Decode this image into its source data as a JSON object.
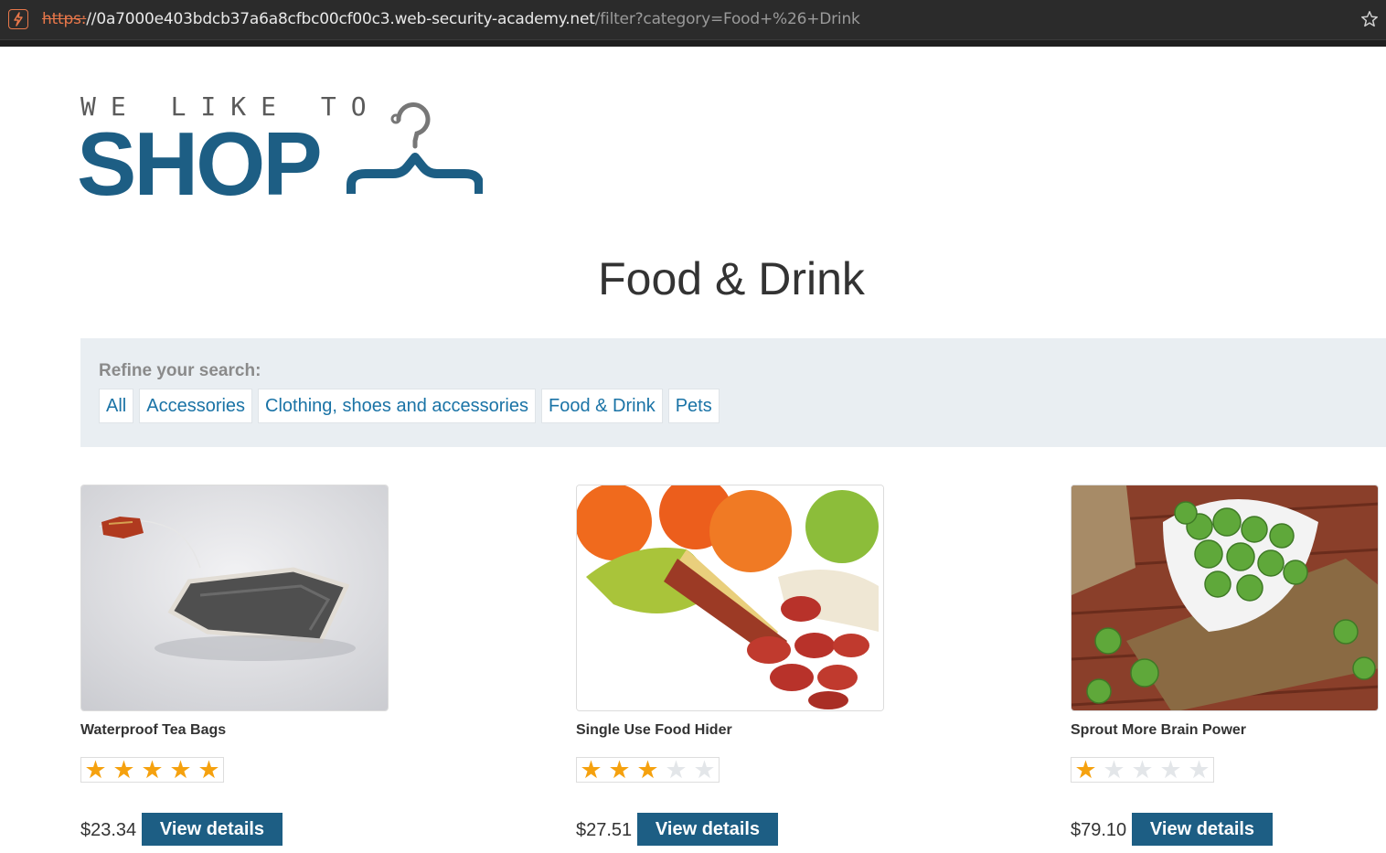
{
  "browser": {
    "url_scheme": "https:",
    "url_host": "//0a7000e403bdcb37a6a8cfbc00cf00c3.web-security-academy.net",
    "url_path": "/filter?category=Food+%26+Drink"
  },
  "logo": {
    "tagline": "WE LIKE TO",
    "brand": "SHOP"
  },
  "page_title": "Food & Drink",
  "filters": {
    "label": "Refine your search:",
    "items": [
      "All",
      "Accessories",
      "Clothing, shoes and accessories",
      "Food & Drink",
      "Pets"
    ]
  },
  "products": [
    {
      "name": "Waterproof Tea Bags",
      "rating": 5,
      "price": "$23.34",
      "button": "View details"
    },
    {
      "name": "Single Use Food Hider",
      "rating": 3,
      "price": "$27.51",
      "button": "View details"
    },
    {
      "name": "Sprout More Brain Power",
      "rating": 1,
      "price": "$79.10",
      "button": "View details"
    }
  ],
  "colors": {
    "brand_blue": "#1d5e84",
    "link_blue": "#1a73a6",
    "star_on": "#f5a10e",
    "star_off": "#e3e6e9"
  }
}
